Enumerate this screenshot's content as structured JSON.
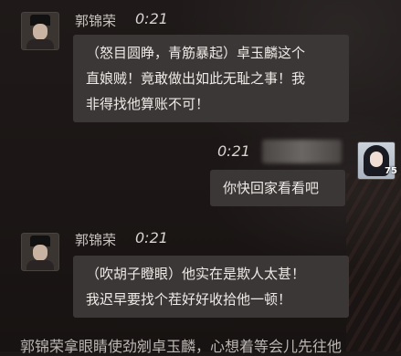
{
  "messages": [
    {
      "sender": "郭锦荣",
      "time": "0:21",
      "lines": [
        "（怒目圆睁，青筋暴起）卓玉麟这个",
        "直娘贼！竟敢做出如此无耻之事！我",
        "非得找他算账不可！"
      ]
    },
    {
      "sender": "",
      "time": "0:21",
      "level": "75",
      "lines": [
        "你快回家看看吧"
      ]
    },
    {
      "sender": "郭锦荣",
      "time": "0:21",
      "lines": [
        "（吹胡子瞪眼）他实在是欺人太甚！",
        "我迟早要找个茬好好收拾他一顿！"
      ]
    }
  ],
  "narration": "郭锦荣拿眼睛使劲剜卓玉麟，心想着等会儿先往他"
}
